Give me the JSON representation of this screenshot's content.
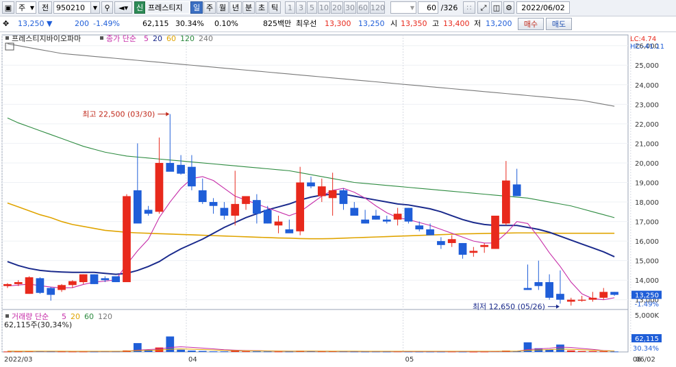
{
  "toolbar": {
    "market": "주",
    "prev_label": "전",
    "code": "950210",
    "badge_new": "신",
    "stock_name": "프레스티지",
    "periods": [
      "일",
      "주",
      "월",
      "년",
      "분",
      "초",
      "틱"
    ],
    "active_period": "일",
    "minute_steps": [
      "1",
      "3",
      "5",
      "10",
      "20",
      "30",
      "60",
      "120"
    ],
    "view_count": "60",
    "total_count": "/326",
    "date": "2022/06/02"
  },
  "info": {
    "price": "13,250",
    "change": "200",
    "change_pct": "-1.49%",
    "volume": "62,115",
    "turnover_pct": "30.34%",
    "rate2": "0.10%",
    "amount": "825백만",
    "best_label": "최우선",
    "best_ask": "13,300",
    "best_bid": "13,250",
    "open_label": "시",
    "open": "13,350",
    "high_label": "고",
    "high": "13,400",
    "low_label": "저",
    "low": "13,200",
    "buy_label": "매수",
    "sell_label": "매도"
  },
  "colors": {
    "up": "#e8291c",
    "down": "#1f5ed8",
    "ma5": "#c62ca8",
    "ma20": "#1a2a8c",
    "ma60": "#e0a400",
    "ma120": "#2b8a3e",
    "ma240": "#777777"
  },
  "legend": {
    "name": "프레스티지바이오파마",
    "ma_prefix": "종가 단순",
    "periods": [
      "5",
      "20",
      "60",
      "120",
      "240"
    ],
    "vol_prefix": "거래량 단순",
    "vol_periods": [
      "5",
      "20",
      "60",
      "120"
    ],
    "vol_current": "62,115주(30,34%)"
  },
  "annotations": {
    "high": "최고 22,500 (03/30)",
    "low": "최저 12,650 (05/26)",
    "lc": "LC:4.74",
    "hc": "HC:-41.11"
  },
  "right_panel": {
    "price_tag": "13,250",
    "price_pct": "-1.49%",
    "vol_tag": "62,115",
    "vol_pct": "30.34%",
    "vol_axis_top": "5,000K"
  },
  "x_labels": [
    {
      "idx": 0,
      "label": "2022/03"
    },
    {
      "idx": 17,
      "label": "04"
    },
    {
      "idx": 37,
      "label": "05"
    },
    {
      "idx": 58,
      "label": "06"
    }
  ],
  "x_end_label": "06/02",
  "chart_data": {
    "type": "candlestick",
    "ylim": [
      12500,
      26200
    ],
    "yticks": [
      13000,
      14000,
      15000,
      16000,
      17000,
      18000,
      19000,
      20000,
      21000,
      22000,
      23000,
      24000,
      25000,
      26000
    ],
    "ytick_labels": [
      "13,000",
      "14,000",
      "15,000",
      "16,000",
      "17,000",
      "18,000",
      "19,000",
      "20,000",
      "21,000",
      "22,000",
      "23,000",
      "24,000",
      "25,000",
      "26,000"
    ],
    "candles": [
      [
        13700,
        13850,
        13600,
        13800
      ],
      [
        13800,
        14000,
        13700,
        13900
      ],
      [
        13300,
        14200,
        13300,
        14150
      ],
      [
        14100,
        14150,
        13300,
        13350
      ],
      [
        13600,
        13650,
        12950,
        13250
      ],
      [
        13500,
        13800,
        13400,
        13750
      ],
      [
        13750,
        14000,
        13600,
        13950
      ],
      [
        13900,
        14300,
        13800,
        14300
      ],
      [
        14300,
        14300,
        13800,
        13800
      ],
      [
        14100,
        14200,
        13900,
        14000
      ],
      [
        14200,
        14200,
        13900,
        13900
      ],
      [
        13900,
        18400,
        13900,
        18300
      ],
      [
        18600,
        21000,
        17100,
        16900
      ],
      [
        17600,
        17800,
        17300,
        17400
      ],
      [
        17500,
        21300,
        17400,
        20000
      ],
      [
        20000,
        22500,
        19600,
        19550
      ],
      [
        19900,
        20400,
        19400,
        19450
      ],
      [
        19800,
        20400,
        18600,
        18800
      ],
      [
        18600,
        19200,
        17900,
        18000
      ],
      [
        18000,
        18200,
        17400,
        17800
      ],
      [
        17700,
        18000,
        17100,
        17300
      ],
      [
        17300,
        19600,
        16800,
        17900
      ],
      [
        17900,
        18200,
        17600,
        18300
      ],
      [
        18100,
        18400,
        16900,
        17400
      ],
      [
        17600,
        17800,
        16900,
        16900
      ],
      [
        16800,
        17300,
        16400,
        17000
      ],
      [
        16600,
        17100,
        16500,
        16400
      ],
      [
        16500,
        19800,
        16300,
        19000
      ],
      [
        19000,
        19300,
        18700,
        18800
      ],
      [
        18300,
        19200,
        18000,
        18800
      ],
      [
        18200,
        19500,
        17300,
        18600
      ],
      [
        18600,
        18700,
        17600,
        17900
      ],
      [
        17700,
        18000,
        17300,
        17300
      ],
      [
        17100,
        17600,
        16900,
        16900
      ],
      [
        17300,
        17600,
        17100,
        17100
      ],
      [
        17100,
        17300,
        16900,
        17000
      ],
      [
        17100,
        17700,
        16800,
        17400
      ],
      [
        17700,
        17700,
        16900,
        17000
      ],
      [
        16800,
        17000,
        16500,
        16600
      ],
      [
        16600,
        16900,
        16400,
        16300
      ],
      [
        16000,
        16200,
        15600,
        15800
      ],
      [
        15900,
        16300,
        15700,
        16100
      ],
      [
        15900,
        15900,
        15100,
        15300
      ],
      [
        15400,
        15700,
        15200,
        15500
      ],
      [
        15700,
        15900,
        15400,
        15800
      ],
      [
        15600,
        16200,
        15600,
        17300
      ],
      [
        16900,
        20100,
        16800,
        19100
      ],
      [
        18900,
        19700,
        18500,
        18300
      ],
      [
        13600,
        14800,
        13500,
        13500
      ],
      [
        13900,
        15000,
        13500,
        13700
      ],
      [
        13900,
        14300,
        13000,
        13100
      ],
      [
        13300,
        14500,
        12800,
        13000
      ],
      [
        12900,
        13100,
        12700,
        13000
      ],
      [
        13000,
        13200,
        12900,
        13000
      ],
      [
        13000,
        13400,
        12900,
        13100
      ],
      [
        13100,
        13600,
        13000,
        13400
      ],
      [
        13400,
        13400,
        13200,
        13250
      ]
    ],
    "ma5": [
      13700,
      13750,
      13800,
      13720,
      13650,
      13600,
      13620,
      13780,
      13900,
      13950,
      14020,
      14800,
      15500,
      16100,
      17200,
      18000,
      18700,
      19200,
      19300,
      19100,
      18700,
      18300,
      18100,
      17900,
      17700,
      17500,
      17300,
      17500,
      17900,
      18300,
      18600,
      18700,
      18500,
      18200,
      17800,
      17450,
      17200,
      17100,
      16950,
      16800,
      16600,
      16400,
      16200,
      16000,
      15900,
      15900,
      16400,
      17000,
      16900,
      16200,
      15400,
      14700,
      13900,
      13300,
      13050,
      13000,
      13100
    ],
    "ma20": [
      14950,
      14750,
      14600,
      14500,
      14450,
      14420,
      14400,
      14400,
      14400,
      14350,
      14300,
      14350,
      14500,
      14700,
      14950,
      15300,
      15600,
      15850,
      16100,
      16400,
      16700,
      16950,
      17200,
      17400,
      17600,
      17750,
      17900,
      18100,
      18250,
      18350,
      18400,
      18400,
      18300,
      18200,
      18100,
      18000,
      17900,
      17850,
      17750,
      17650,
      17500,
      17300,
      17100,
      16950,
      16850,
      16800,
      16800,
      16800,
      16700,
      16600,
      16450,
      16250,
      16050,
      15850,
      15650,
      15450,
      15200
    ],
    "ma60": [
      17950,
      17750,
      17550,
      17350,
      17200,
      17000,
      16850,
      16750,
      16650,
      16550,
      16500,
      16450,
      16420,
      16400,
      16380,
      16360,
      16340,
      16320,
      16300,
      16280,
      16260,
      16240,
      16220,
      16200,
      16180,
      16160,
      16150,
      16130,
      16120,
      16120,
      16130,
      16150,
      16170,
      16190,
      16210,
      16230,
      16250,
      16270,
      16290,
      16310,
      16330,
      16350,
      16370,
      16380,
      16390,
      16400,
      16410,
      16420,
      16420,
      16420,
      16410,
      16400,
      16400,
      16400,
      16400,
      16400,
      16400
    ],
    "ma120": [
      22300,
      22050,
      21850,
      21650,
      21450,
      21250,
      21050,
      20850,
      20700,
      20550,
      20450,
      20350,
      20300,
      20250,
      20200,
      20150,
      20100,
      20050,
      20000,
      19950,
      19900,
      19850,
      19800,
      19750,
      19700,
      19650,
      19600,
      19500,
      19400,
      19300,
      19200,
      19100,
      19000,
      18950,
      18900,
      18850,
      18800,
      18750,
      18700,
      18650,
      18600,
      18550,
      18500,
      18450,
      18400,
      18350,
      18300,
      18250,
      18200,
      18100,
      18000,
      17900,
      17800,
      17650,
      17500,
      17350,
      17200
    ],
    "ma240": [
      26100,
      26000,
      25900,
      25800,
      25700,
      25600,
      25550,
      25500,
      25450,
      25400,
      25350,
      25300,
      25250,
      25200,
      25150,
      25100,
      25050,
      25000,
      24950,
      24900,
      24850,
      24800,
      24750,
      24700,
      24650,
      24600,
      24550,
      24500,
      24450,
      24400,
      24350,
      24300,
      24250,
      24200,
      24150,
      24100,
      24050,
      24000,
      23950,
      23900,
      23850,
      23800,
      23750,
      23700,
      23650,
      23600,
      23550,
      23500,
      23450,
      23400,
      23350,
      23300,
      23250,
      23200,
      23100,
      23000,
      22900
    ],
    "volume_ylim": [
      0,
      5300
    ],
    "volume": [
      60,
      70,
      90,
      110,
      80,
      70,
      60,
      60,
      60,
      90,
      80,
      200,
      1200,
      260,
      600,
      2100,
      300,
      180,
      130,
      80,
      80,
      160,
      90,
      80,
      70,
      60,
      60,
      160,
      110,
      80,
      90,
      80,
      60,
      50,
      60,
      50,
      70,
      60,
      50,
      50,
      50,
      60,
      50,
      40,
      50,
      100,
      180,
      90,
      1300,
      500,
      300,
      1000,
      200,
      120,
      110,
      90,
      62
    ],
    "volume_ma5": [
      100,
      95,
      90,
      85,
      80,
      78,
      75,
      70,
      70,
      72,
      75,
      90,
      250,
      330,
      400,
      600,
      700,
      620,
      520,
      420,
      300,
      240,
      200,
      180,
      140,
      120,
      100,
      100,
      110,
      100,
      90,
      85,
      80,
      75,
      70,
      65,
      60,
      58,
      55,
      55,
      55,
      55,
      55,
      55,
      55,
      60,
      80,
      95,
      320,
      420,
      500,
      650,
      600,
      480,
      350,
      200,
      120
    ]
  }
}
